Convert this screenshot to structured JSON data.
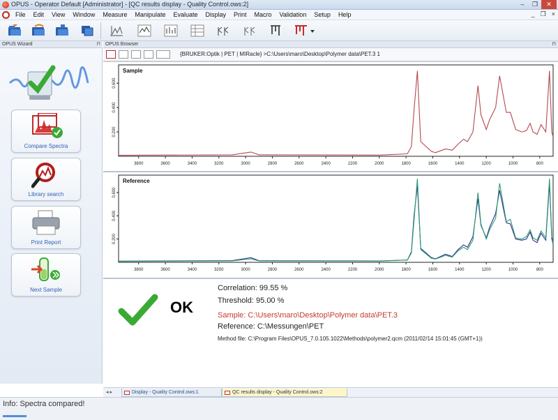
{
  "window": {
    "title": "OPUS - Operator Default [Administrator] - [QC results display - Quality Control.ows:2]",
    "controls": {
      "minimize": "–",
      "restore": "❐",
      "close": "✕"
    }
  },
  "menu": {
    "items": [
      "File",
      "Edit",
      "View",
      "Window",
      "Measure",
      "Manipulate",
      "Evaluate",
      "Display",
      "Print",
      "Macro",
      "Validation",
      "Setup",
      "Help"
    ],
    "mdi_controls": [
      "_",
      "❐",
      "×"
    ]
  },
  "wizard": {
    "header": "OPUS Wizard",
    "pin": "⊓",
    "items": [
      {
        "label": "Compare Spectra",
        "icon": "compare-spectra-icon"
      },
      {
        "label": "Library search",
        "icon": "magnifier-icon"
      },
      {
        "label": "Print Report",
        "icon": "printer-icon"
      },
      {
        "label": "Next Sample",
        "icon": "next-sample-icon"
      }
    ]
  },
  "browser": {
    "header": "OPUS Browser",
    "pin": "⊓",
    "path": "{BRUKER:Optik | PET | MIRacle} >C:\\Users\\maro\\Desktop\\Polymer data\\PET.3  1"
  },
  "plots": {
    "sample_title": "Sample",
    "reference_title": "Reference",
    "x_ticks": [
      "3800",
      "3600",
      "3400",
      "3200",
      "3000",
      "2800",
      "2600",
      "2400",
      "2200",
      "2000",
      "1800",
      "1600",
      "1400",
      "1200",
      "1000",
      "800"
    ],
    "y_ticks": [
      "0.200",
      "0.400",
      "0.600"
    ]
  },
  "chart_data": [
    {
      "type": "line",
      "title": "Sample",
      "xlabel": "",
      "ylabel": "",
      "xlim": [
        3950,
        700
      ],
      "ylim": [
        0,
        0.75
      ],
      "x_ticks": [
        3800,
        3600,
        3400,
        3200,
        3000,
        2800,
        2600,
        2400,
        2200,
        2000,
        1800,
        1600,
        1400,
        1200,
        1000,
        800
      ],
      "y_ticks": [
        0.2,
        0.4,
        0.6
      ],
      "grid": false,
      "series": [
        {
          "color": "#b4474f",
          "x": [
            3950,
            3100,
            2960,
            2900,
            2000,
            1790,
            1760,
            1740,
            1715,
            1690,
            1610,
            1580,
            1505,
            1455,
            1410,
            1370,
            1340,
            1300,
            1262,
            1240,
            1200,
            1175,
            1130,
            1100,
            1050,
            1020,
            980,
            935,
            900,
            872,
            850,
            820,
            790,
            755,
            727,
            710,
            700
          ],
          "y": [
            0.008,
            0.012,
            0.035,
            0.012,
            0.01,
            0.02,
            0.08,
            0.38,
            0.7,
            0.12,
            0.04,
            0.03,
            0.06,
            0.05,
            0.1,
            0.14,
            0.12,
            0.2,
            0.58,
            0.34,
            0.22,
            0.3,
            0.4,
            0.66,
            0.36,
            0.36,
            0.22,
            0.2,
            0.21,
            0.27,
            0.2,
            0.18,
            0.26,
            0.2,
            0.7,
            0.2,
            0.16
          ]
        }
      ]
    },
    {
      "type": "line",
      "title": "Reference",
      "xlabel": "",
      "ylabel": "",
      "xlim": [
        3950,
        700
      ],
      "ylim": [
        0,
        0.75
      ],
      "x_ticks": [
        3800,
        3600,
        3400,
        3200,
        3000,
        2800,
        2600,
        2400,
        2200,
        2000,
        1800,
        1600,
        1400,
        1200,
        1000,
        800
      ],
      "y_ticks": [
        0.2,
        0.4,
        0.6
      ],
      "grid": false,
      "series": [
        {
          "color": "#2a2f8f",
          "x": [
            3950,
            3100,
            2960,
            2900,
            2000,
            1790,
            1760,
            1740,
            1715,
            1690,
            1610,
            1580,
            1505,
            1455,
            1410,
            1370,
            1340,
            1300,
            1262,
            1240,
            1200,
            1175,
            1130,
            1100,
            1050,
            1020,
            980,
            935,
            900,
            872,
            850,
            820,
            790,
            755,
            727,
            710,
            700
          ],
          "y": [
            0.01,
            0.015,
            0.04,
            0.014,
            0.012,
            0.02,
            0.09,
            0.4,
            0.66,
            0.12,
            0.04,
            0.03,
            0.07,
            0.05,
            0.11,
            0.15,
            0.13,
            0.22,
            0.55,
            0.32,
            0.21,
            0.3,
            0.42,
            0.62,
            0.34,
            0.33,
            0.2,
            0.19,
            0.2,
            0.26,
            0.19,
            0.17,
            0.25,
            0.19,
            0.68,
            0.2,
            0.16
          ]
        },
        {
          "color": "#2e9a73",
          "x": [
            3950,
            3100,
            2960,
            2900,
            2000,
            1790,
            1760,
            1740,
            1715,
            1690,
            1610,
            1580,
            1505,
            1455,
            1410,
            1370,
            1340,
            1300,
            1262,
            1240,
            1200,
            1175,
            1130,
            1100,
            1050,
            1020,
            980,
            935,
            900,
            872,
            850,
            820,
            790,
            755,
            727,
            710,
            700
          ],
          "y": [
            0.008,
            0.012,
            0.03,
            0.012,
            0.01,
            0.02,
            0.08,
            0.36,
            0.72,
            0.11,
            0.035,
            0.028,
            0.06,
            0.045,
            0.1,
            0.13,
            0.11,
            0.19,
            0.6,
            0.33,
            0.2,
            0.28,
            0.38,
            0.68,
            0.35,
            0.37,
            0.21,
            0.2,
            0.22,
            0.28,
            0.21,
            0.19,
            0.27,
            0.21,
            0.72,
            0.22,
            0.17
          ]
        }
      ]
    }
  ],
  "qc": {
    "result": "OK",
    "correlation": "Correlation:  99.55 %",
    "threshold": "Threshold:  95.00 %",
    "sample": "Sample:  C:\\Users\\maro\\Desktop\\Polymer data\\PET.3",
    "reference": "Reference:  C:\\Messungen\\PET",
    "method": "Method file:  C:\\Program Files\\OPUS_7.0.105.1022\\Methods\\polymer2.qcm (2011/02/14 15:01:45 (GMT+1))",
    "colors": {
      "check": "#3aaa35",
      "sample_text": "#c23b34"
    }
  },
  "tabs": [
    {
      "label": "Display - Quality Control.ows:1",
      "active": false
    },
    {
      "label": "QC results display - Quality Control.ows:2",
      "active": true
    }
  ],
  "tab_arrows": "◂ ▸",
  "status": {
    "info": "Info: Spectra compared!"
  }
}
